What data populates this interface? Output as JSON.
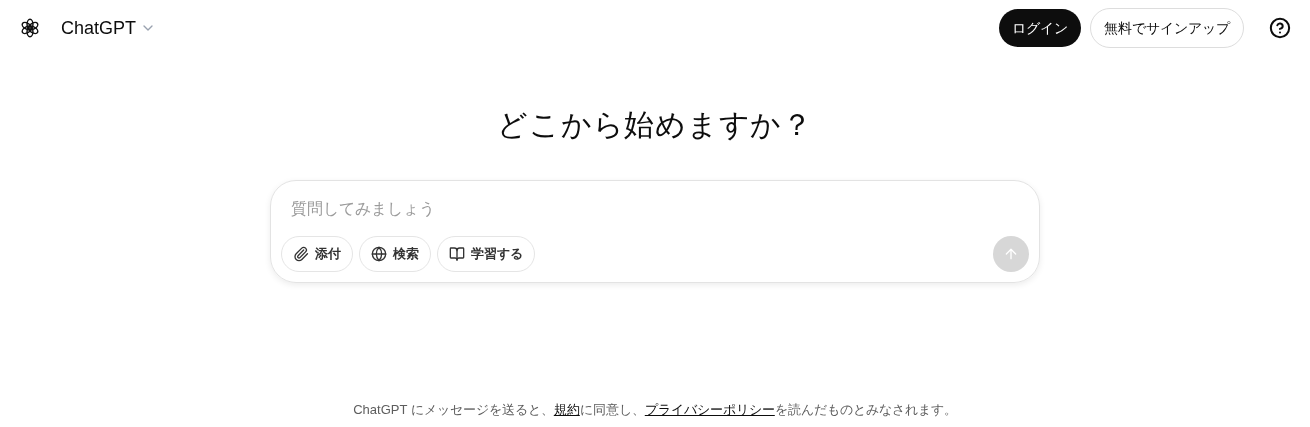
{
  "header": {
    "model_name": "ChatGPT",
    "buttons": [
      {
        "label": "ログイン",
        "kind": "primary"
      },
      {
        "label": "無料でサインアップ",
        "kind": "outline"
      }
    ]
  },
  "heading": "どこから始めますか？",
  "composer": {
    "placeholder": "質問してみましょう",
    "tools": [
      {
        "label": "添付",
        "kind": "attach"
      },
      {
        "label": "検索",
        "kind": "search"
      },
      {
        "label": "学習する",
        "kind": "study"
      }
    ],
    "send_disabled": true
  },
  "footer": [
    {
      "kind": "text",
      "text": "ChatGPT にメッセージを送ると、"
    },
    {
      "kind": "link",
      "text": "規約"
    },
    {
      "kind": "text",
      "text": "に同意し、"
    },
    {
      "kind": "link",
      "text": "プライバシーポリシー"
    },
    {
      "kind": "text",
      "text": "を読んだものとみなされます。"
    }
  ]
}
